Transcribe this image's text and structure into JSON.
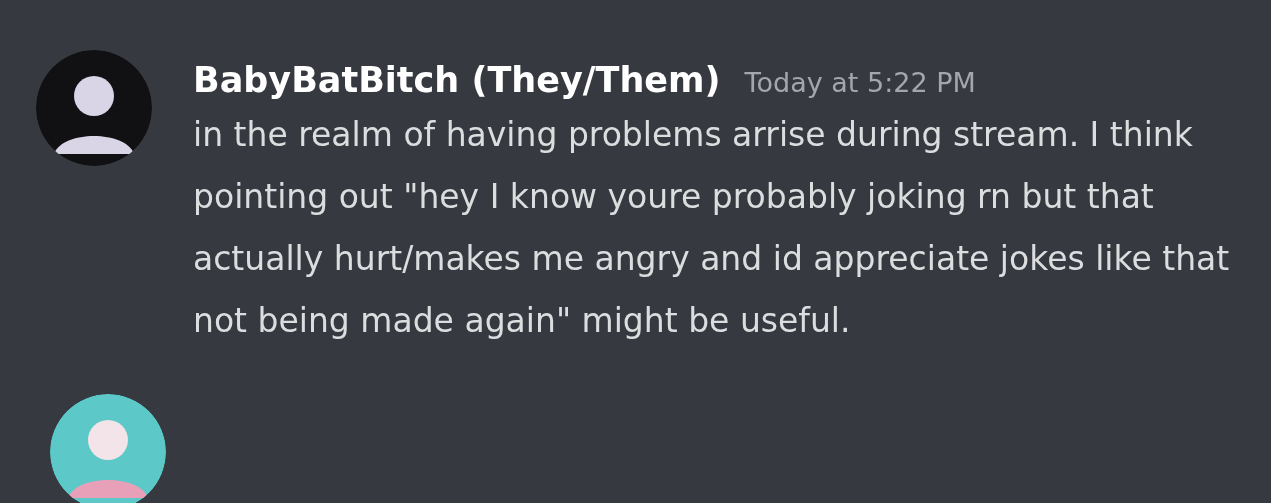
{
  "messages": [
    {
      "author": "BabyBatBitch (They/Them)",
      "timestamp": "Today at 5:22 PM",
      "text": "in the realm of having problems arrise during stream. I think pointing out \"hey I know youre probably joking rn but that actually hurt/makes me angry and id appreciate jokes like that not being made again\" might be useful."
    }
  ],
  "next_message": {
    "kind": "avatar-only"
  }
}
